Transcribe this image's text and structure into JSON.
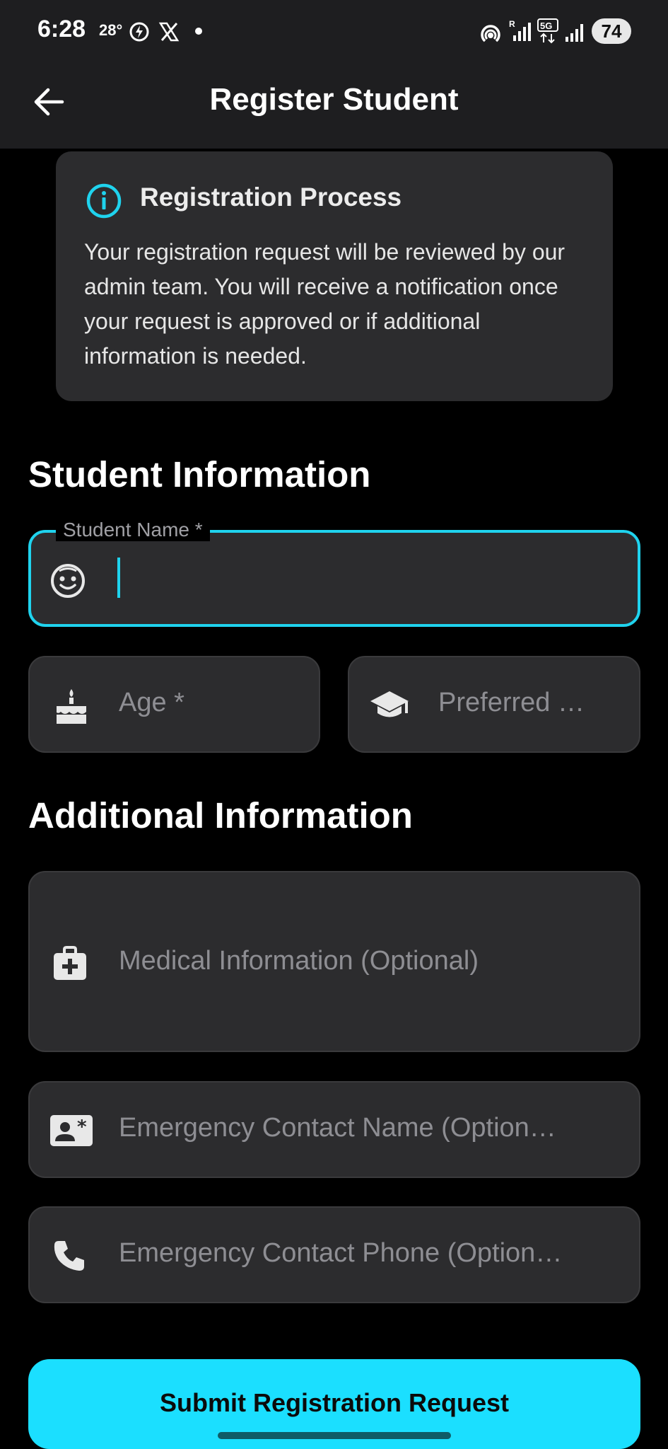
{
  "status_bar": {
    "time": "6:28",
    "temperature": "28°",
    "battery": "74",
    "icons": [
      "flash-icon",
      "x-logo-icon",
      "notification-dot-icon",
      "hotspot-icon",
      "roaming-signal-icon",
      "5g-icon",
      "signal-icon"
    ]
  },
  "app_bar": {
    "title": "Register Student",
    "back_icon": "arrow-left-icon"
  },
  "info_card": {
    "icon": "info-icon",
    "title": "Registration Process",
    "body": "Your registration request will be reviewed by our admin team. You will receive a notification once your request is approved or if additional information is needed."
  },
  "student_section": {
    "title": "Student Information",
    "name_field": {
      "label": "Student Name *",
      "value": "",
      "icon": "face-icon"
    },
    "age_field": {
      "placeholder": "Age *",
      "icon": "cake-icon"
    },
    "preferred_field": {
      "placeholder": "Preferred …",
      "icon": "graduation-cap-icon"
    }
  },
  "additional_section": {
    "title": "Additional Information",
    "medical_field": {
      "placeholder": "Medical Information (Optional)",
      "icon": "medical-kit-icon"
    },
    "emergency_name_field": {
      "placeholder": "Emergency Contact Name (Option…",
      "icon": "contact-card-icon"
    },
    "emergency_phone_field": {
      "placeholder": "Emergency Contact Phone (Option…",
      "icon": "phone-icon"
    }
  },
  "submit": {
    "label": "Submit Registration Request"
  },
  "colors": {
    "accent": "#1bdfff",
    "focus_border": "#1fd3ee",
    "surface": "#2c2c2e",
    "background": "#000000"
  }
}
